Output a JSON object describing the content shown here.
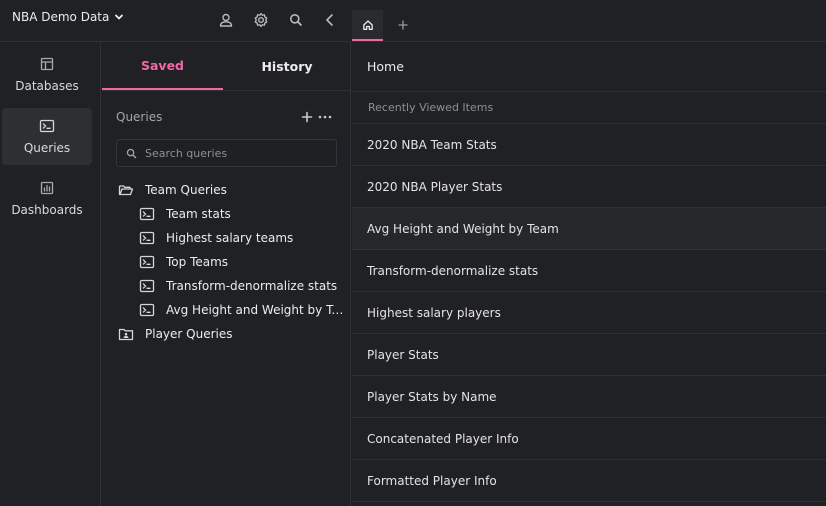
{
  "app": {
    "database_name": "NBA Demo Data"
  },
  "rail": {
    "items": [
      {
        "label": "Databases",
        "icon": "table-icon",
        "active": false
      },
      {
        "label": "Queries",
        "icon": "terminal-icon",
        "active": true
      },
      {
        "label": "Dashboards",
        "icon": "chart-icon",
        "active": false
      }
    ]
  },
  "panel": {
    "tabs": {
      "saved": "Saved",
      "history": "History"
    },
    "active_tab": "Saved",
    "queries_label": "Queries",
    "search": {
      "placeholder": "Search queries",
      "value": ""
    },
    "folders": [
      {
        "label": "Team Queries",
        "expanded": true,
        "queries": [
          "Team stats",
          "Highest salary teams",
          "Top Teams",
          "Transform-denormalize stats",
          "Avg Height and Weight by Team"
        ]
      },
      {
        "label": "Player Queries",
        "expanded": false,
        "queries": []
      }
    ]
  },
  "main": {
    "home_title": "Home",
    "recent_header": "Recently Viewed Items",
    "recent_items": [
      "2020 NBA Team Stats",
      "2020 NBA Player Stats",
      "Avg Height and Weight by Team",
      "Transform-denormalize stats",
      "Highest salary players",
      "Player Stats",
      "Player Stats by Name",
      "Concatenated Player Info",
      "Formatted Player Info"
    ],
    "highlighted_item": "Avg Height and Weight by Team"
  },
  "colors": {
    "accent": "#ee6aa7",
    "background": "#202124",
    "border": "#303136"
  }
}
